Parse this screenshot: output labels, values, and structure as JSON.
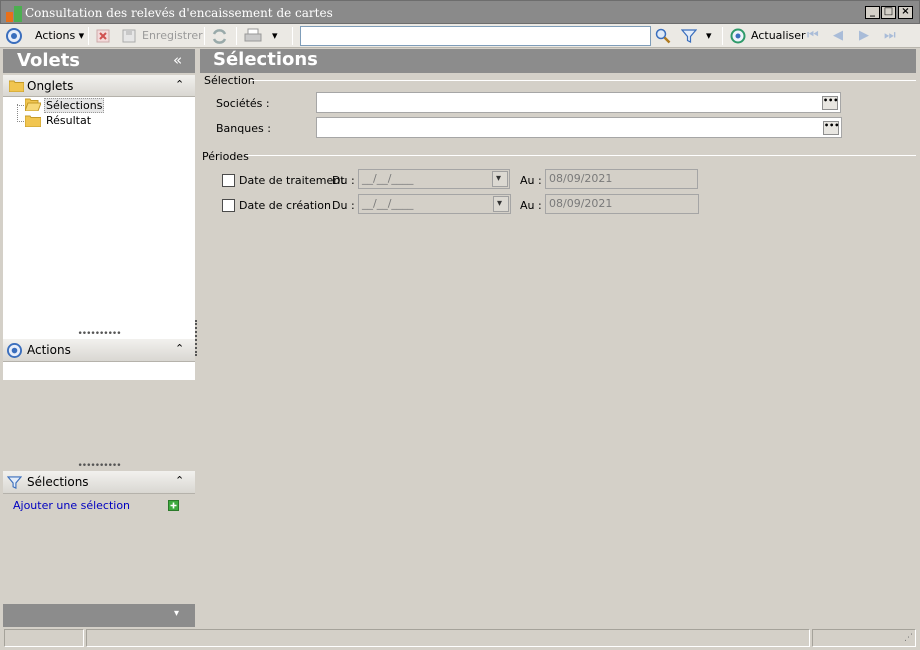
{
  "window": {
    "title": "Consultation des relevés d'encaissement de cartes"
  },
  "toolbar": {
    "actions_label": "Actions",
    "save_label": "Enregistrer",
    "search_value": "",
    "refresh_label": "Actualiser"
  },
  "left_panel": {
    "title": "Volets",
    "collapse_glyph": "«",
    "tabs_section": {
      "title": "Onglets",
      "items": [
        {
          "label": "Sélections",
          "selected": true
        },
        {
          "label": "Résultat",
          "selected": false
        }
      ]
    },
    "actions_section": {
      "title": "Actions"
    },
    "selections_section": {
      "title": "Sélections",
      "add_label": "Ajouter une sélection"
    }
  },
  "main": {
    "title": "Sélections",
    "selection_group": "Sélection",
    "fields": [
      {
        "label": "Sociétés :",
        "value": ""
      },
      {
        "label": "Banques :",
        "value": ""
      }
    ],
    "periods_group": "Périodes",
    "periods": [
      {
        "label": "Date de traitement",
        "du_label": "Du :",
        "du_value": "__/__/____",
        "au_label": "Au :",
        "au_value": "08/09/2021",
        "checked": false
      },
      {
        "label": "Date de création",
        "du_label": "Du :",
        "du_value": "__/__/____",
        "au_label": "Au :",
        "au_value": "08/09/2021",
        "checked": false
      }
    ]
  },
  "colors": {
    "band": "#8c8c8c",
    "link": "#0000c0",
    "accent_blue": "#3a6ebd"
  }
}
